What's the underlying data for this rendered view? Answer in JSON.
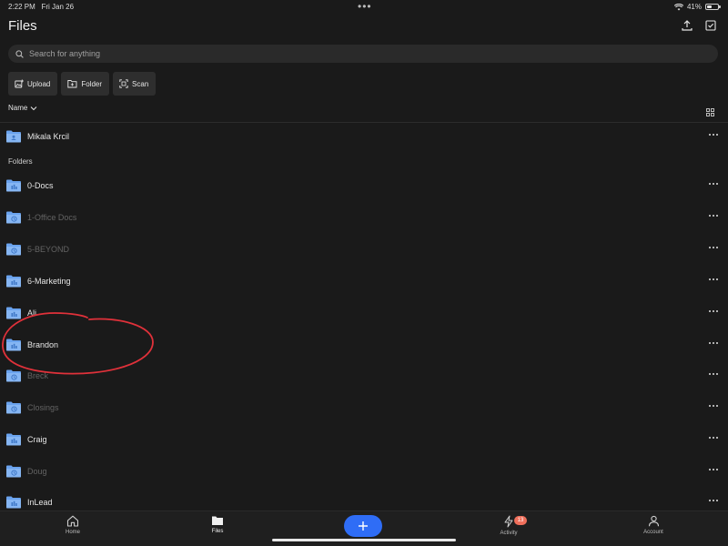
{
  "status_bar": {
    "time": "2:22 PM",
    "date": "Fri Jan 26",
    "battery": "41%"
  },
  "header": {
    "title": "Files"
  },
  "search": {
    "placeholder": "Search for anything"
  },
  "actions": [
    {
      "label": "Upload",
      "icon": "upload-image-icon"
    },
    {
      "label": "Folder",
      "icon": "new-folder-icon"
    },
    {
      "label": "Scan",
      "icon": "scan-icon"
    }
  ],
  "sort": {
    "label": "Name"
  },
  "shared_item": {
    "label": "Mikala Krcil",
    "icon": "shared-folder-icon"
  },
  "folders_section": {
    "label": "Folders"
  },
  "folders": [
    {
      "label": "0-Docs",
      "dim": false,
      "icon": "team-folder-icon"
    },
    {
      "label": "1-Office Docs",
      "dim": true,
      "icon": "sync-folder-icon"
    },
    {
      "label": "5-BEYOND",
      "dim": true,
      "icon": "sync-folder-icon"
    },
    {
      "label": "6-Marketing",
      "dim": false,
      "icon": "team-folder-icon"
    },
    {
      "label": "Ali",
      "dim": false,
      "icon": "team-folder-icon"
    },
    {
      "label": "Brandon",
      "dim": false,
      "icon": "team-folder-icon"
    },
    {
      "label": "Breck",
      "dim": true,
      "icon": "sync-folder-icon"
    },
    {
      "label": "Closings",
      "dim": true,
      "icon": "sync-folder-icon"
    },
    {
      "label": "Craig",
      "dim": false,
      "icon": "team-folder-icon"
    },
    {
      "label": "Doug",
      "dim": true,
      "icon": "sync-folder-icon"
    },
    {
      "label": "InLead",
      "dim": false,
      "icon": "team-folder-icon"
    }
  ],
  "tabs": {
    "home": {
      "label": "Home"
    },
    "files": {
      "label": "Files"
    },
    "activity": {
      "label": "Activity",
      "badge": "13"
    },
    "account": {
      "label": "Account"
    }
  },
  "colors": {
    "accent": "#2f6df6",
    "folder": "#6aa3ee",
    "badge": "#ef6f5b",
    "annotation": "#e0313a"
  }
}
